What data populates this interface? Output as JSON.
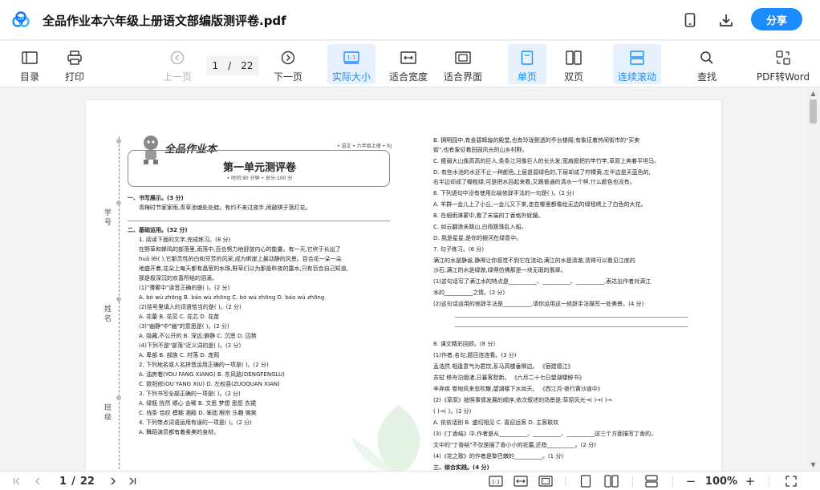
{
  "window": {
    "title": "全品作业本六年级上册语文部编版测评卷.pdf",
    "share_label": "分享"
  },
  "toolbar": {
    "outline": "目录",
    "print": "打印",
    "prev_page": "上一页",
    "current_page": "1",
    "page_sep": "/",
    "total_pages": "22",
    "next_page": "下一页",
    "actual_size": "实际大小",
    "fit_width": "适合宽度",
    "fit_page": "适合界面",
    "single_page": "单页",
    "double_page": "双页",
    "continuous_scroll": "连续滚动",
    "search": "查找",
    "pdf_to_word": "PDF转Word",
    "actual_size_icon_text": "1:1"
  },
  "bottom": {
    "current_page": "1",
    "page_sep": "/",
    "total_pages": "22",
    "zoom": "100%",
    "zoom_minus": "−",
    "zoom_plus": "+",
    "actual_size_icon_text": "1:1"
  },
  "paper": {
    "brand": "全品作业本",
    "brand_sub": "• 语文 • 六年级上册 • RJ",
    "title": "第一单元测评卷",
    "meta": "• 时间:90 分钟    • 总分:100 分",
    "binding_labels": [
      "学  号",
      "姓  名",
      "班  级"
    ],
    "left": [
      {
        "t": "一、书写展示。(3 分)",
        "s": true
      },
      {
        "t": "    青梅时节家家雨,青草池塘处处蛙。有约不来过夜半,闲敲棋子落灯花。"
      },
      {
        "t": "二、基础运用。(32 分)",
        "s": true
      },
      {
        "t": "1. 阅读下面的文字,完成练习。(8 分)"
      },
      {
        "t": "    在野草和蜂鸣的部落里,雨落中,百合努力地舒放内心的能量。有一天,它终于长出了"
      },
      {
        "t": "huā lěi(      ),它那灵性的白和芬芳的风采,成为断崖上最动静的风景。百合花一朵一朵"
      },
      {
        "t": "地盛开着,花朵上每天都有晶莹的水珠,野草们以为那是昨夜的露水,只有百合自己知道,"
      },
      {
        "t": "那是极深沉的欢喜所结的泪滴。"
      },
      {
        "t": "(1)\"薄雾中\"读音正确的是(      )。(2 分)"
      },
      {
        "t": "   A. bó wù zhōng        B. báo wù zhōng        C. bó wú zhōng        D. báo wú zhōng"
      },
      {
        "t": "(2)括号里填入的词语恰当的是(      )。(2 分)"
      },
      {
        "t": "   A. 花蕾                  B. 花蕊                  C. 花芯                  D. 花苗"
      },
      {
        "t": "(3)\"幽静\"中\"幽\"的意思是(      )。(2 分)"
      },
      {
        "t": "   A. 隐藏,不公开的        B. 深远;僻静            C. 沉思                  D. 囚禁"
      },
      {
        "t": "(4)下列不是\"部落\"近义词的是(      )。(2 分)"
      },
      {
        "t": "   A. 卑部                  B. 部族                  C. 村落                  D. 庞观"
      },
      {
        "t": "2. 下列地名或人名拼音运用正确的一项是(      )。(2 分)"
      },
      {
        "t": "   A. 油房巷(YOU FANG XIANG)                    B. 东风路(DENGFENGLU)"
      },
      {
        "t": "   C. 欧阳修(OU YANG XIU)                        D. 左权县(ZUOQUAN XIAN)"
      },
      {
        "t": "3. 下列书写全部正确的一项是(      )。(2 分)"
      },
      {
        "t": "   A. 绿瓶   恍然   顺心   会稀                 B. 文思   梦想   思怨   衣裙"
      },
      {
        "t": "   C. 线条   恰叹   模糊   酒殿                 D. 笨拙   眼帘   乐趣   微笑"
      },
      {
        "t": "4. 下列带点词语运用有误的一项是(      )。(2 分)"
      },
      {
        "t": "   A. 舞蹈演员都有着柔美的身材。"
      }
    ],
    "right": [
      {
        "t": "B. 拥明园中,有金碧辉煌的殿堂,也有玲珑剔透的亭台楼阁;有象征着热闹街市的\"买卖"
      },
      {
        "t": "   街\",也有象征着田园风光的山乡村野。"
      },
      {
        "t": "C. 瘦弱大山像高高的巨人,条条江河像巨人的长头发;宽肩膀把钓竿竹竿,草原上奔着平坦马。"
      },
      {
        "t": "D. 有些水池的水还不止一种颜色,上层是碧绿色的,下层却成了柠檬黄;左半边是天蓝色的,"
      },
      {
        "t": "   右半边却成了橄榄绿;可是把水舀起来看,又跟普通的清水一个样,什么颜色也没有。"
      },
      {
        "t": "6. 下列语句中没有使用比喻修辞手法的一句是(      )。(2 分)"
      },
      {
        "t": "A. 羊群一会儿上了小丘,一会儿又下来,走在哪里都像给无边的绿毯绣上了白色的大花。"
      },
      {
        "t": "B. 在细雨淋蒙中,看了末端的丁香格外妩媚。"
      },
      {
        "t": "C. 如云翻浪未跳山,白雨跳珠乱入船。"
      },
      {
        "t": "D. 我是星星,是你的银河在绿意中。"
      },
      {
        "t": "7. 句子练习。(6 分)"
      },
      {
        "t": "    满江的水是静谧,静得让你感觉不到它在流动;满江的水是清澈,清得可以看见江底的"
      },
      {
        "t": "沙石;满江的水是绿澈,绿得仿佛那是一块无瑕的翡翠。"
      },
      {
        "t": "(1)这句话写了满江水的特点是__________、__________、__________,表达出作者对漓江"
      },
      {
        "t": "    水的__________之情。(2 分)"
      },
      {
        "t": "(2)这句话运用的修辞手法是__________,请你运用这一修辞手法描写一处美景。(4 分)"
      },
      {
        "t": "8. 课文精彩回顾。(8 分)"
      },
      {
        "t": "(1)作者,名句,题目连连看。(3 分)"
      },
      {
        "t": "    孟浩然          相逢意气为君饮,系马高楼垂柳边。            《宿建德江》"
      },
      {
        "t": "    苏轼              移舟泊烟渚,日暮客愁新。                      《六月二十七日望湖楼醉书》"
      },
      {
        "t": "    辛弃疾          卷地风来忽吹散,望湖楼下水如天。            《西江月·夜行黄沙道中》"
      },
      {
        "t": "(2)《草原》按照事情发展的顺序,依次叙述的场景是:草原风光→(      )→(      )→"
      },
      {
        "t": "    (      )→(      )。(2 分)"
      },
      {
        "t": "    A. 依依话别            B. 盛切相见              C. 喜迎远客              D. 主客联欢"
      },
      {
        "t": "(3)《丁香结》中,作者是从__________、__________、__________这三个方面描写丁香的。"
      },
      {
        "t": "    文中的\"丁香结\"不仅是描了香小小的花蕾,还指__________。(2 分)"
      },
      {
        "t": "(4)《花之歌》的作者是黎巴嫩的__________。(1 分)"
      },
      {
        "t": "三、综合实践。(4 分)",
        "s": true
      }
    ]
  }
}
